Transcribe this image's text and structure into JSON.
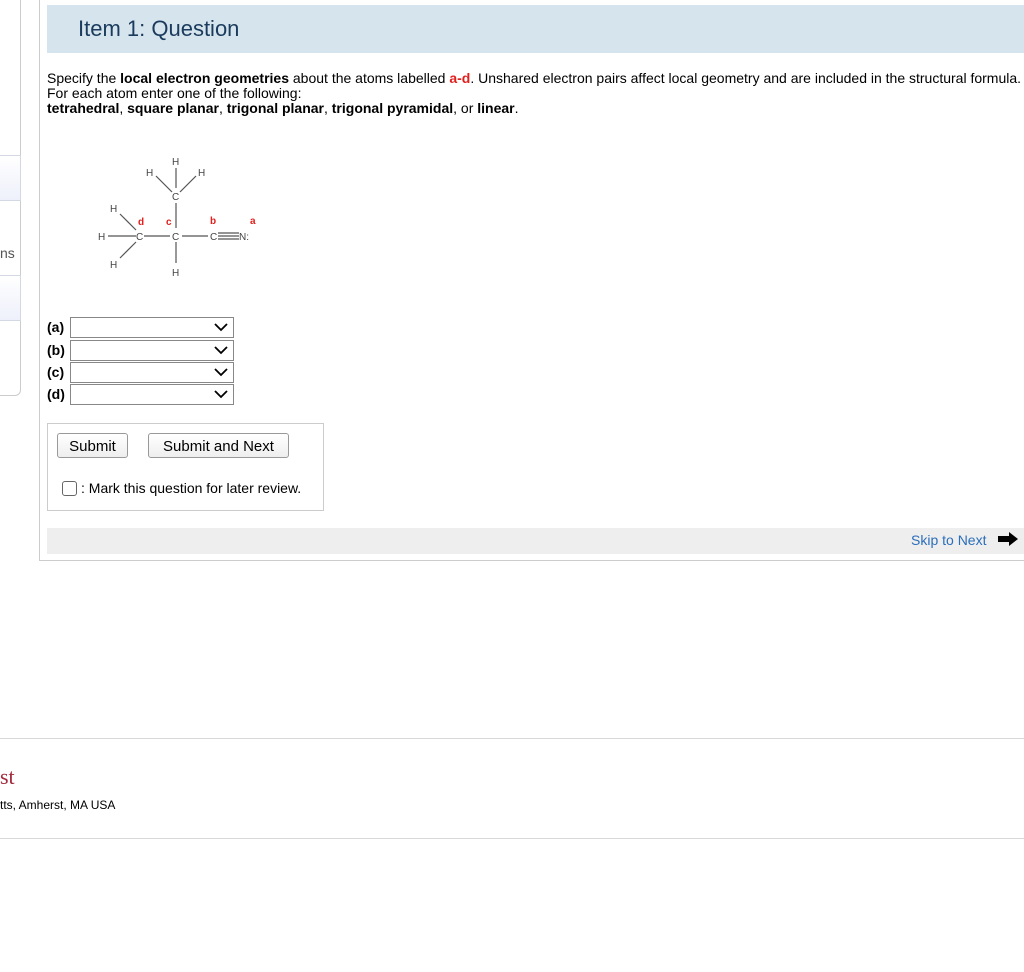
{
  "sidebar": {
    "partial_label": "ns"
  },
  "item": {
    "title": "Item 1: Question"
  },
  "question": {
    "p1_a": "Specify the ",
    "p1_b": "local electron geometries",
    "p1_c": " about the atoms labelled ",
    "p1_d": "a-d",
    "p1_e": ". Unshared electron pairs affect local geometry and are included in the structural formula.",
    "p2": "For each atom enter one of the following:",
    "options": [
      "tetrahedral",
      "square planar",
      "trigonal planar",
      "trigonal pyramidal",
      "linear"
    ],
    "sep1": ", ",
    "sep_or": ", or ",
    "end": "."
  },
  "molecule": {
    "atom_labels": [
      "a",
      "b",
      "c",
      "d"
    ],
    "label_color": "#e0201c"
  },
  "answers": [
    {
      "label": "(a)",
      "value": ""
    },
    {
      "label": "(b)",
      "value": ""
    },
    {
      "label": "(c)",
      "value": ""
    },
    {
      "label": "(d)",
      "value": ""
    }
  ],
  "buttons": {
    "submit": "Submit",
    "submit_next": "Submit and Next"
  },
  "review": {
    "label": ": Mark this question for later review.",
    "checked": false
  },
  "skip": {
    "label": "Skip to Next"
  },
  "footer": {
    "logo_partial": "st",
    "address": "tts, Amherst, MA USA"
  }
}
